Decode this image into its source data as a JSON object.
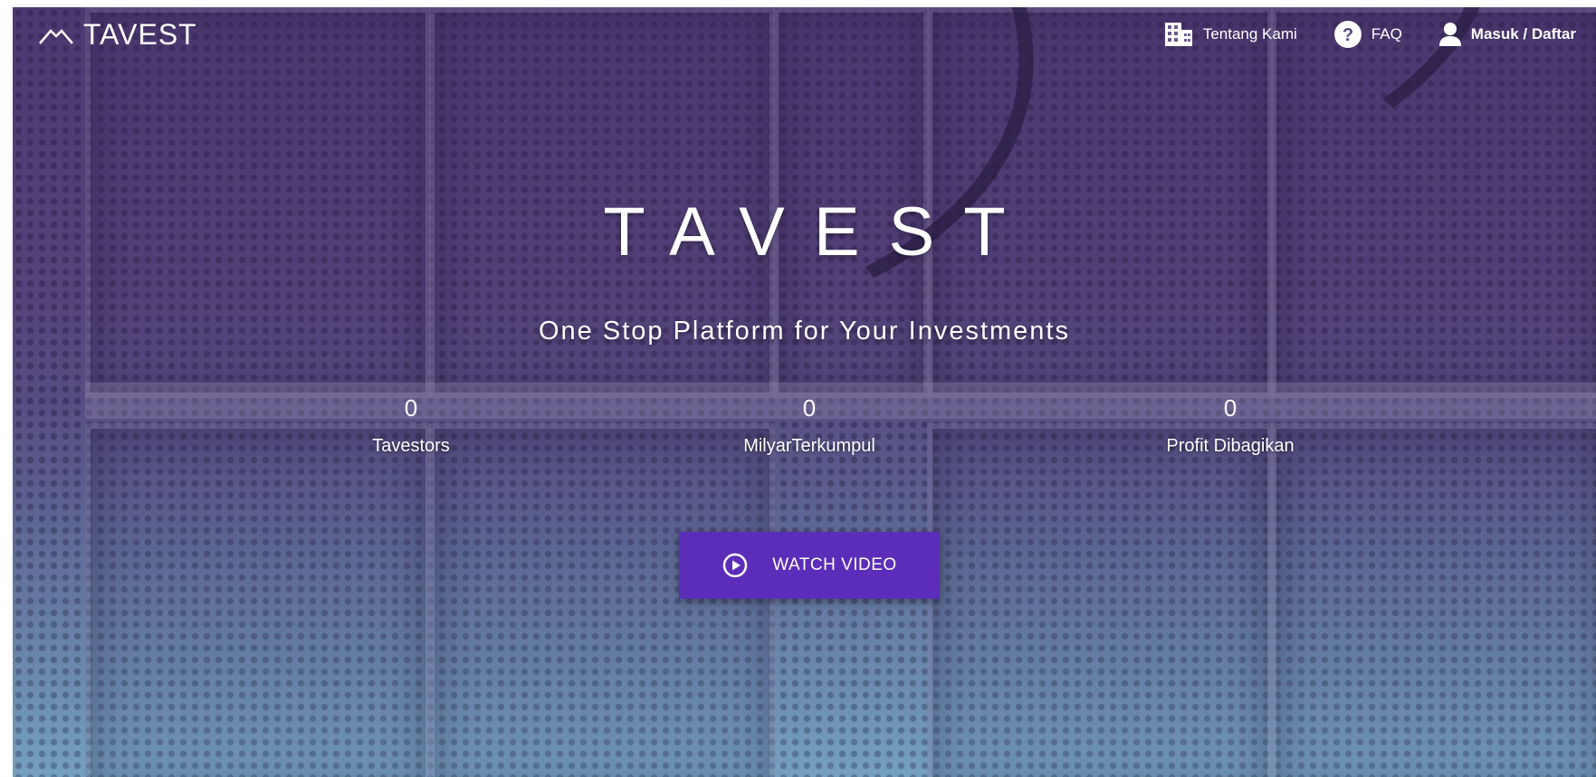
{
  "nav": {
    "logo_text": "TAVEST",
    "items": [
      {
        "label": "Tentang Kami",
        "icon": "building-icon"
      },
      {
        "label": "FAQ",
        "icon": "help-circle-icon"
      },
      {
        "label": "Masuk / Daftar",
        "icon": "user-icon"
      }
    ]
  },
  "hero": {
    "title": "TAVEST",
    "subtitle": "One Stop Platform for Your Investments",
    "stats": [
      {
        "value": "0",
        "label": "Tavestors"
      },
      {
        "value": "0",
        "label": "MilyarTerkumpul"
      },
      {
        "value": "0",
        "label": "Profit Dibagikan"
      }
    ],
    "watch_button": {
      "label": "WATCH VIDEO",
      "icon": "play-circle-icon"
    }
  },
  "colors": {
    "accent_button": "#5b2db8",
    "text": "#ffffff"
  }
}
